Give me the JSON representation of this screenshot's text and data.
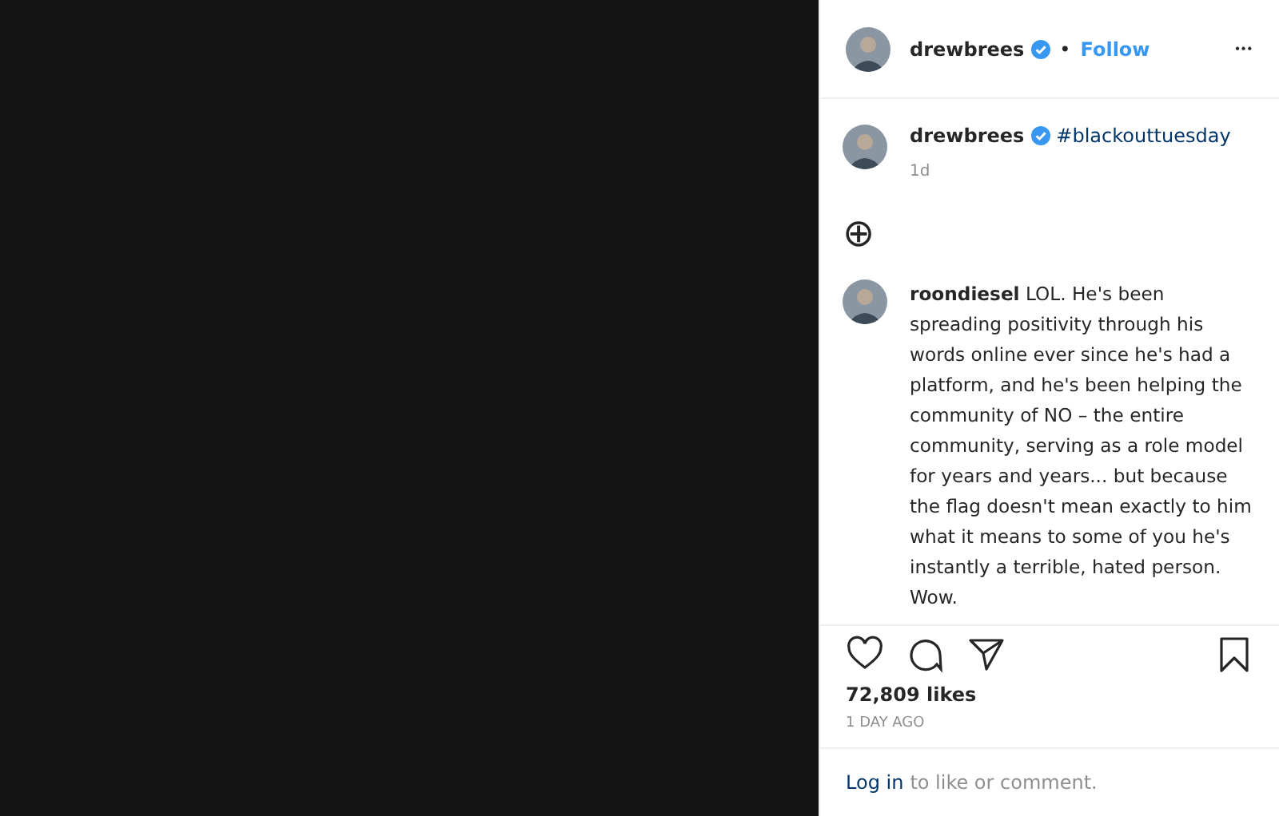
{
  "header": {
    "username": "drewbrees",
    "verified": true,
    "separator": "•",
    "follow": "Follow",
    "more": "•••"
  },
  "caption": {
    "username": "drewbrees",
    "verified": true,
    "text": "#blackouttuesday",
    "time": "1d"
  },
  "more_comments": {
    "icon": "⊕"
  },
  "comments": [
    {
      "text": "**roondiesel** LOL. He's been spreading positivity through his words online ever since he's had a platform, and he's been helping the community of NO – the entire community, serving as a role model for years and years... but because the flag doesn't mean exactly to him what it means to some of you he's instantly a terrible, hated person. Wow."
    }
  ],
  "likes": "72,809 likes",
  "posted": "1 DAY AGO",
  "login": {
    "link": "Log in",
    "text": "to like or comment."
  }
}
